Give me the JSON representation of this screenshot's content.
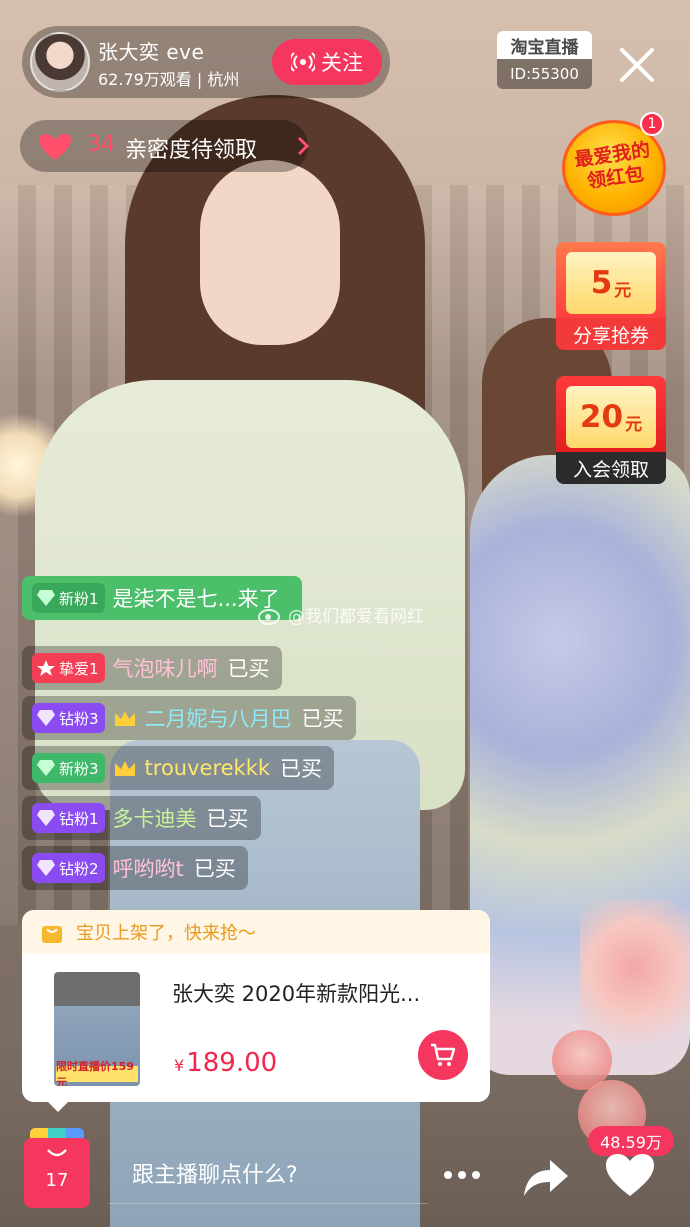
{
  "host": {
    "name": "张大奕 eve",
    "viewers": "62.79万观看",
    "location": "杭州",
    "follow_label": "关注"
  },
  "channel": {
    "logo": "淘宝直播",
    "id": "ID:55300"
  },
  "intimacy": {
    "count": "34",
    "label": "亲密度待领取"
  },
  "red_packet": {
    "text": "最爱我的领红包",
    "badge": "1"
  },
  "coupons": [
    {
      "amount": "5",
      "unit": "元",
      "label": "分享抢券"
    },
    {
      "amount": "20",
      "unit": "元",
      "label": "入会领取"
    }
  ],
  "chat": [
    {
      "badge": "新粉1",
      "badge_color": "green",
      "name": "是柒不是七...来了",
      "action": "",
      "highlight": true
    },
    {
      "badge": "挚爱1",
      "badge_color": "red",
      "name": "气泡味儿啊",
      "action": "已买"
    },
    {
      "badge": "钻粉3",
      "badge_color": "purple",
      "crown": true,
      "name": "二月妮与八月巴",
      "action": "已买"
    },
    {
      "badge": "新粉3",
      "badge_color": "green",
      "crown": true,
      "name": "trouverekkk",
      "action": "已买"
    },
    {
      "badge": "钻粉1",
      "badge_color": "purple",
      "name": "多卡迪美",
      "action": "已买"
    },
    {
      "badge": "钻粉2",
      "badge_color": "purple",
      "name": "呼哟哟t",
      "action": "已买"
    }
  ],
  "watermark": "@我们都爱看网红",
  "product": {
    "header": "宝贝上架了，快来抢～",
    "title": "张大奕 2020年新款阳光...",
    "currency": "¥",
    "price": "189.00",
    "thumb_tag": "限时直播价159元"
  },
  "bottom": {
    "cart_count": "17",
    "chat_placeholder": "跟主播聊点什么?",
    "likes": "48.59万"
  },
  "colors": {
    "accent": "#f5375f",
    "price": "#f2254b",
    "highlight_row": "#4cbf6b",
    "fan_purple": "#8a4cf0"
  }
}
